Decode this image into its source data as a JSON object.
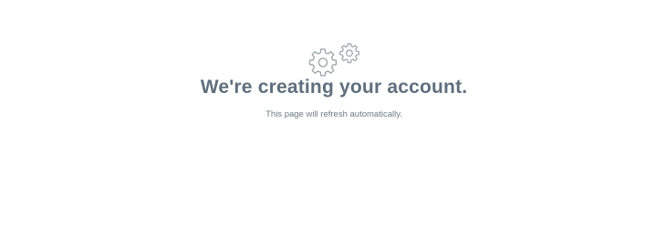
{
  "status": {
    "icon": "gears-icon",
    "icon_color": "#9aa3a8",
    "headline": "We're creating your account.",
    "message": "This page will refresh automatically."
  },
  "colors": {
    "background": "#ffffff",
    "headline": "#5f6f7e",
    "message": "#6b7985"
  }
}
